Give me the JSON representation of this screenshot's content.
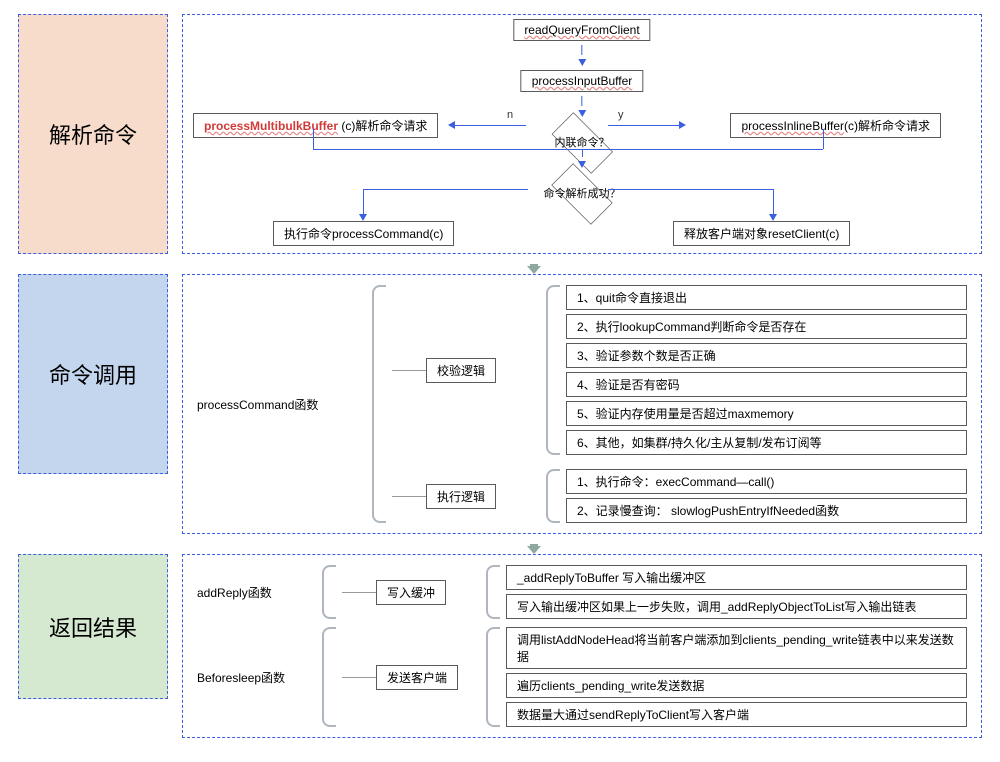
{
  "sections": {
    "parse": "解析命令",
    "invoke": "命令调用",
    "result": "返回结果"
  },
  "parse": {
    "readQuery": "readQueryFromClient",
    "procInput": "processInputBuffer",
    "multibulk_fn": "processMultibulkBuffer",
    "multibulk_suffix": " (c)解析命令请求",
    "inline_fn": "processInlineBuffer",
    "inline_suffix": "(c)解析命令请求",
    "d1": "内联命令？",
    "d1_n": "n",
    "d1_y": "y",
    "d2": "命令解析成功？",
    "exec": "执行命令processCommand(c)",
    "release": "释放客户端对象resetClient(c)"
  },
  "invoke": {
    "lead": "processCommand函数",
    "sub1": "校验逻辑",
    "sub2": "执行逻辑",
    "checks": [
      "1、quit命令直接退出",
      "2、执行lookupCommand判断命令是否存在",
      "3、验证参数个数是否正确",
      "4、验证是否有密码",
      "5、验证内存使用量是否超过maxmemory",
      "6、其他，如集群/持久化/主从复制/发布订阅等"
    ],
    "exec": [
      "1、执行命令：execCommand—call()",
      "2、记录慢查询：   slowlogPushEntryIfNeeded函数"
    ]
  },
  "result": {
    "lead1": "addReply函数",
    "lead2": "Beforesleep函数",
    "sub1": "写入缓冲",
    "sub2": "发送客户端",
    "buf": [
      "_addReplyToBuffer 写入输出缓冲区",
      "写入输出缓冲区如果上一步失败，调用_addReplyObjectToList写入输出链表"
    ],
    "send_pre": "调用listAddNodeHead将当前客户端添加到clients_pending_write链表中以来发送数据",
    "send": [
      "遍历clients_pending_write发送数据",
      "数据量大通过sendReplyToClient写入客户端"
    ]
  }
}
